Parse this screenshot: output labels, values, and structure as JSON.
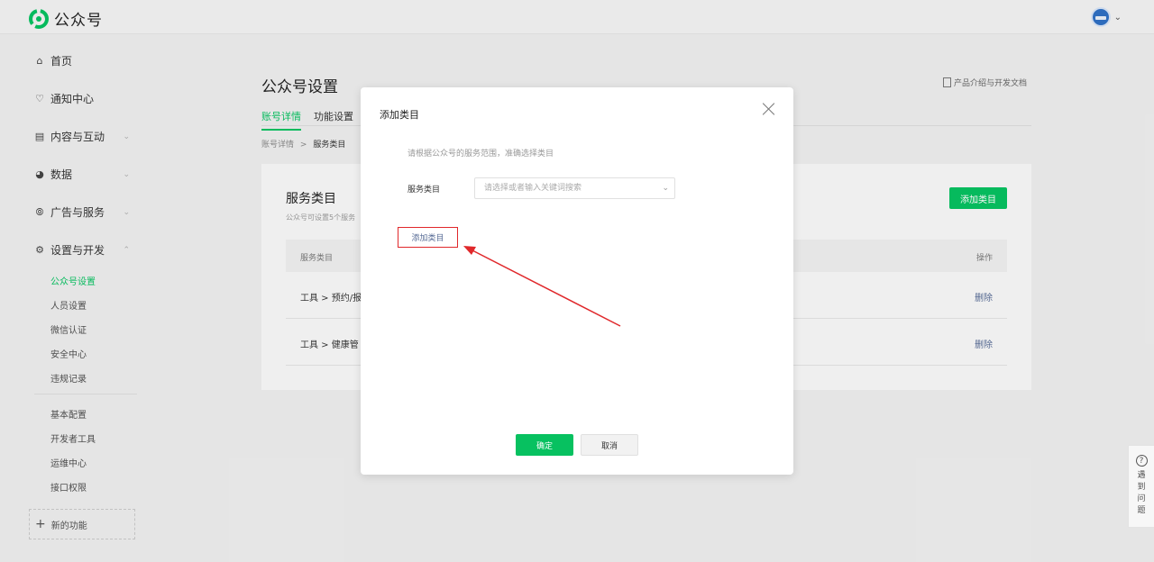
{
  "header": {
    "app_name": "公众号",
    "logo_icon": "wechat-official-account-logo-icon",
    "avatar_icon": "user-avatar-icon",
    "colors": {
      "brand": "#07c160",
      "header_bg": "#f2f2f2"
    }
  },
  "sidebar": {
    "items": [
      {
        "label": "首页",
        "icon": "home-icon"
      },
      {
        "label": "通知中心",
        "icon": "bell-icon"
      },
      {
        "label": "内容与互动",
        "icon": "document-icon"
      },
      {
        "label": "数据",
        "icon": "pie-chart-icon"
      },
      {
        "label": "广告与服务",
        "icon": "compass-icon"
      },
      {
        "label": "设置与开发",
        "icon": "gear-icon"
      }
    ],
    "settings_sub": [
      "公众号设置",
      "人员设置",
      "微信认证",
      "安全中心",
      "违规记录"
    ],
    "dev_sub": [
      "基本配置",
      "开发者工具",
      "运维中心",
      "接口权限"
    ],
    "new_feature": "新的功能"
  },
  "main": {
    "title": "公众号设置",
    "doc_link": "产品介绍与开发文档",
    "tabs": [
      "账号详情",
      "功能设置"
    ],
    "breadcrumb": {
      "parent": "账号详情",
      "sep": ">",
      "current": "服务类目"
    },
    "card": {
      "title": "服务类目",
      "subtitle": "公众号可设置5个服务",
      "add_button": "添加类目",
      "table": {
        "headers": [
          "服务类目",
          "操作"
        ],
        "rows": [
          {
            "category": "工具  >  预约/报",
            "action": "删除"
          },
          {
            "category": "工具  >  健康管",
            "action": "删除"
          }
        ]
      }
    }
  },
  "dialog": {
    "title": "添加类目",
    "hint": "请根据公众号的服务范围，准确选择类目",
    "field_label": "服务类目",
    "select_placeholder": "请选择或者输入关键词搜索",
    "add_link": "添加类目",
    "ok": "确定",
    "cancel": "取消"
  },
  "help": {
    "text": "遇到问题"
  }
}
